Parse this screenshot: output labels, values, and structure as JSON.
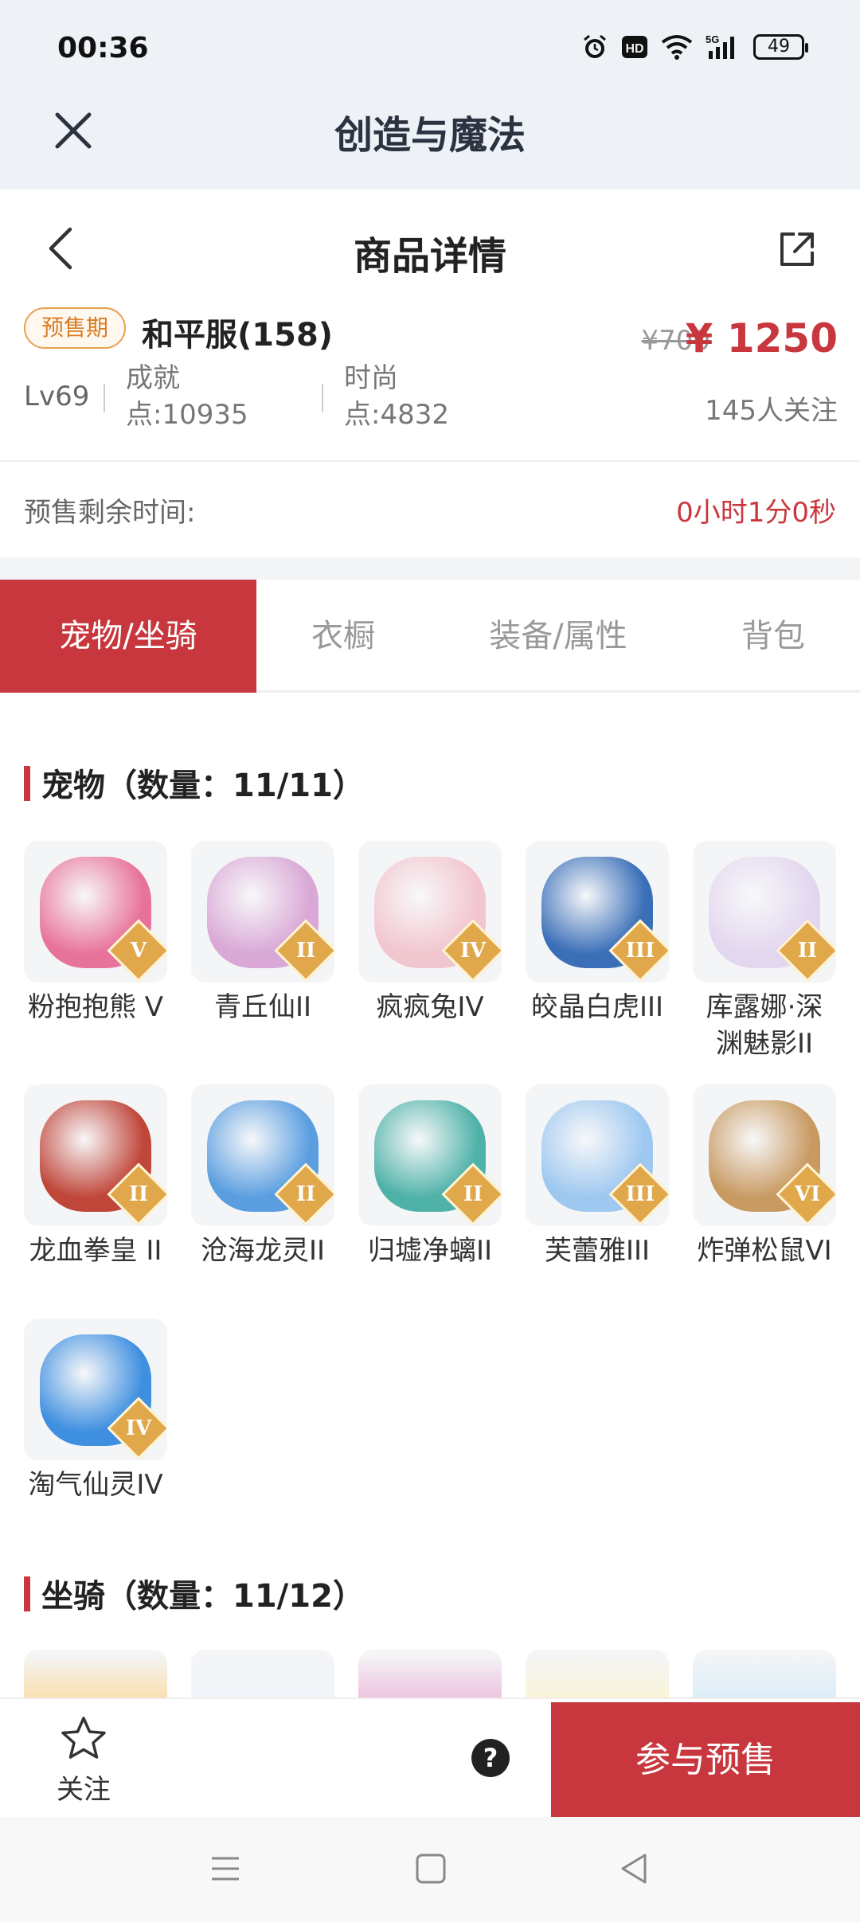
{
  "status_bar": {
    "time": "00:36",
    "battery": "49",
    "icons": [
      "alarm-icon",
      "hd-icon",
      "wifi-icon",
      "5g-signal-icon",
      "battery-icon"
    ]
  },
  "app_bar": {
    "title": "创造与魔法",
    "close_icon": "close-icon"
  },
  "detail_header": {
    "title": "商品详情",
    "back_icon": "back-arrow-icon",
    "share_icon": "share-icon"
  },
  "product": {
    "presale_tag": "预售期",
    "server": "和平服(158)",
    "price_old": "¥700",
    "price_new": "¥ 1250",
    "level": "Lv69",
    "achievement_label": "成就",
    "achievement_value": "点:10935",
    "fashion_label": "时尚",
    "fashion_value": "点:4832",
    "followers": "145人关注"
  },
  "countdown": {
    "label": "预售剩余时间:",
    "value": "0小时1分0秒"
  },
  "tabs": [
    {
      "label": "宠物/坐骑",
      "active": true
    },
    {
      "label": "衣橱",
      "active": false
    },
    {
      "label": "装备/属性",
      "active": false
    },
    {
      "label": "背包",
      "active": false
    }
  ],
  "pets_section": {
    "title": "宠物（数量：11/11）",
    "items": [
      {
        "name": "粉抱抱熊 V",
        "badge": "V",
        "color": "#e8739a"
      },
      {
        "name": "青丘仙II",
        "badge": "II",
        "color": "#d9a8d6"
      },
      {
        "name": "疯疯兔IV",
        "badge": "IV",
        "color": "#f2c6cf"
      },
      {
        "name": "皎晶白虎III",
        "badge": "III",
        "color": "#3a6fb8"
      },
      {
        "name": "库露娜·深渊魅影II",
        "badge": "II",
        "color": "#e3d7ef"
      },
      {
        "name": "龙血拳皇 II",
        "badge": "II",
        "color": "#c0463a"
      },
      {
        "name": "沧海龙灵II",
        "badge": "II",
        "color": "#5a9ee0"
      },
      {
        "name": "归墟净螭II",
        "badge": "II",
        "color": "#4fb2a9"
      },
      {
        "name": "芙蕾雅III",
        "badge": "III",
        "color": "#9ec8f0"
      },
      {
        "name": "炸弹松鼠VI",
        "badge": "VI",
        "color": "#c89a62"
      },
      {
        "name": "淘气仙灵IV",
        "badge": "IV",
        "color": "#3e8fe0"
      }
    ]
  },
  "mounts_section": {
    "title": "坐骑（数量：11/12）",
    "colors": [
      "#f0b23a",
      "#dfe6f4",
      "#d26bb0",
      "#f3e3a0",
      "#a8d3f0"
    ]
  },
  "bottom_bar": {
    "follow_label": "关注",
    "follow_icon": "star-icon",
    "help_icon": "question-icon",
    "help_text": "?",
    "join_label": "参与预售"
  },
  "nav_bar": {
    "icons": [
      "menu-icon",
      "home-icon",
      "back-icon"
    ]
  }
}
